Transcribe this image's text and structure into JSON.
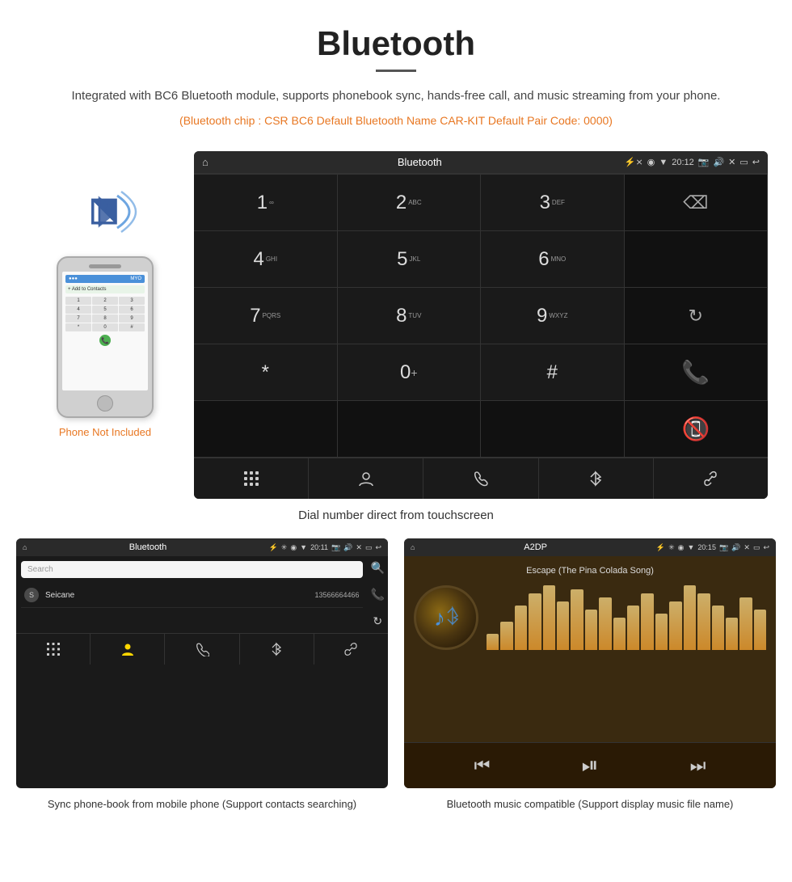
{
  "header": {
    "title": "Bluetooth",
    "description": "Integrated with BC6 Bluetooth module, supports phonebook sync, hands-free call, and music streaming from your phone.",
    "specs": "(Bluetooth chip : CSR BC6    Default Bluetooth Name CAR-KIT    Default Pair Code: 0000)"
  },
  "car_screen": {
    "status_bar": {
      "app_name": "Bluetooth",
      "time": "20:12"
    },
    "dial_keys": [
      {
        "num": "1",
        "sub": "∞"
      },
      {
        "num": "2",
        "sub": "ABC"
      },
      {
        "num": "3",
        "sub": "DEF"
      },
      {
        "num": "⌫",
        "sub": ""
      },
      {
        "num": "4",
        "sub": "GHI"
      },
      {
        "num": "5",
        "sub": "JKL"
      },
      {
        "num": "6",
        "sub": "MNO"
      },
      {
        "num": "",
        "sub": ""
      },
      {
        "num": "7",
        "sub": "PQRS"
      },
      {
        "num": "8",
        "sub": "TUV"
      },
      {
        "num": "9",
        "sub": "WXYZ"
      },
      {
        "num": "↻",
        "sub": ""
      },
      {
        "num": "*",
        "sub": ""
      },
      {
        "num": "0",
        "sub": "+"
      },
      {
        "num": "#",
        "sub": ""
      },
      {
        "num": "📞",
        "sub": ""
      },
      {
        "num": "📵",
        "sub": ""
      }
    ]
  },
  "phone_side": {
    "not_included": "Phone Not Included"
  },
  "main_caption": "Dial number direct from touchscreen",
  "phonebook_screen": {
    "status_bar": {
      "app_name": "Bluetooth",
      "time": "20:11"
    },
    "search_placeholder": "Search",
    "contacts": [
      {
        "letter": "S",
        "name": "Seicane",
        "number": "13566664466"
      }
    ]
  },
  "music_screen": {
    "status_bar": {
      "app_name": "A2DP",
      "time": "20:15"
    },
    "song_name": "Escape (The Pina Colada Song)",
    "eq_bars": [
      20,
      35,
      55,
      70,
      80,
      60,
      75,
      50,
      65,
      40,
      55,
      70,
      45,
      60,
      80,
      70,
      55,
      40,
      65,
      50
    ]
  },
  "bottom_captions": {
    "phonebook": "Sync phone-book from mobile phone\n(Support contacts searching)",
    "music": "Bluetooth music compatible\n(Support display music file name)"
  }
}
